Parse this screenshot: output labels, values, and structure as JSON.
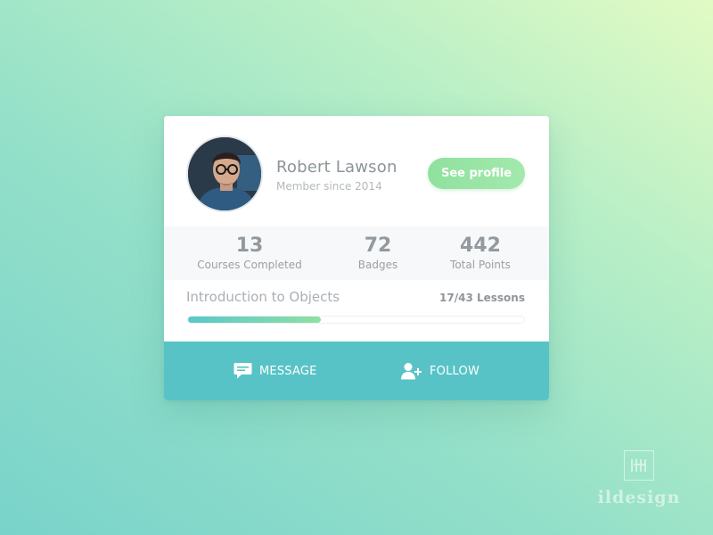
{
  "profile": {
    "name": "Robert Lawson",
    "member_since": "Member since 2014",
    "see_profile_label": "See profile"
  },
  "stats": [
    {
      "value": "13",
      "label": "Courses Completed"
    },
    {
      "value": "72",
      "label": "Badges"
    },
    {
      "value": "442",
      "label": "Total Points"
    }
  ],
  "course": {
    "title": "Introduction to Objects",
    "lessons_text": "17/43 Lessons",
    "completed": 17,
    "total": 43
  },
  "actions": {
    "message_label": "MESSAGE",
    "follow_label": "FOLLOW",
    "message_icon": "chat-bubble-icon",
    "follow_icon": "add-user-icon"
  },
  "colors": {
    "accent_green": "#8fe19e",
    "footer_teal": "#58c3c6",
    "progress_start": "#59c8c9",
    "progress_end": "#8fe0a2"
  },
  "watermark": {
    "text": "ildesign"
  }
}
